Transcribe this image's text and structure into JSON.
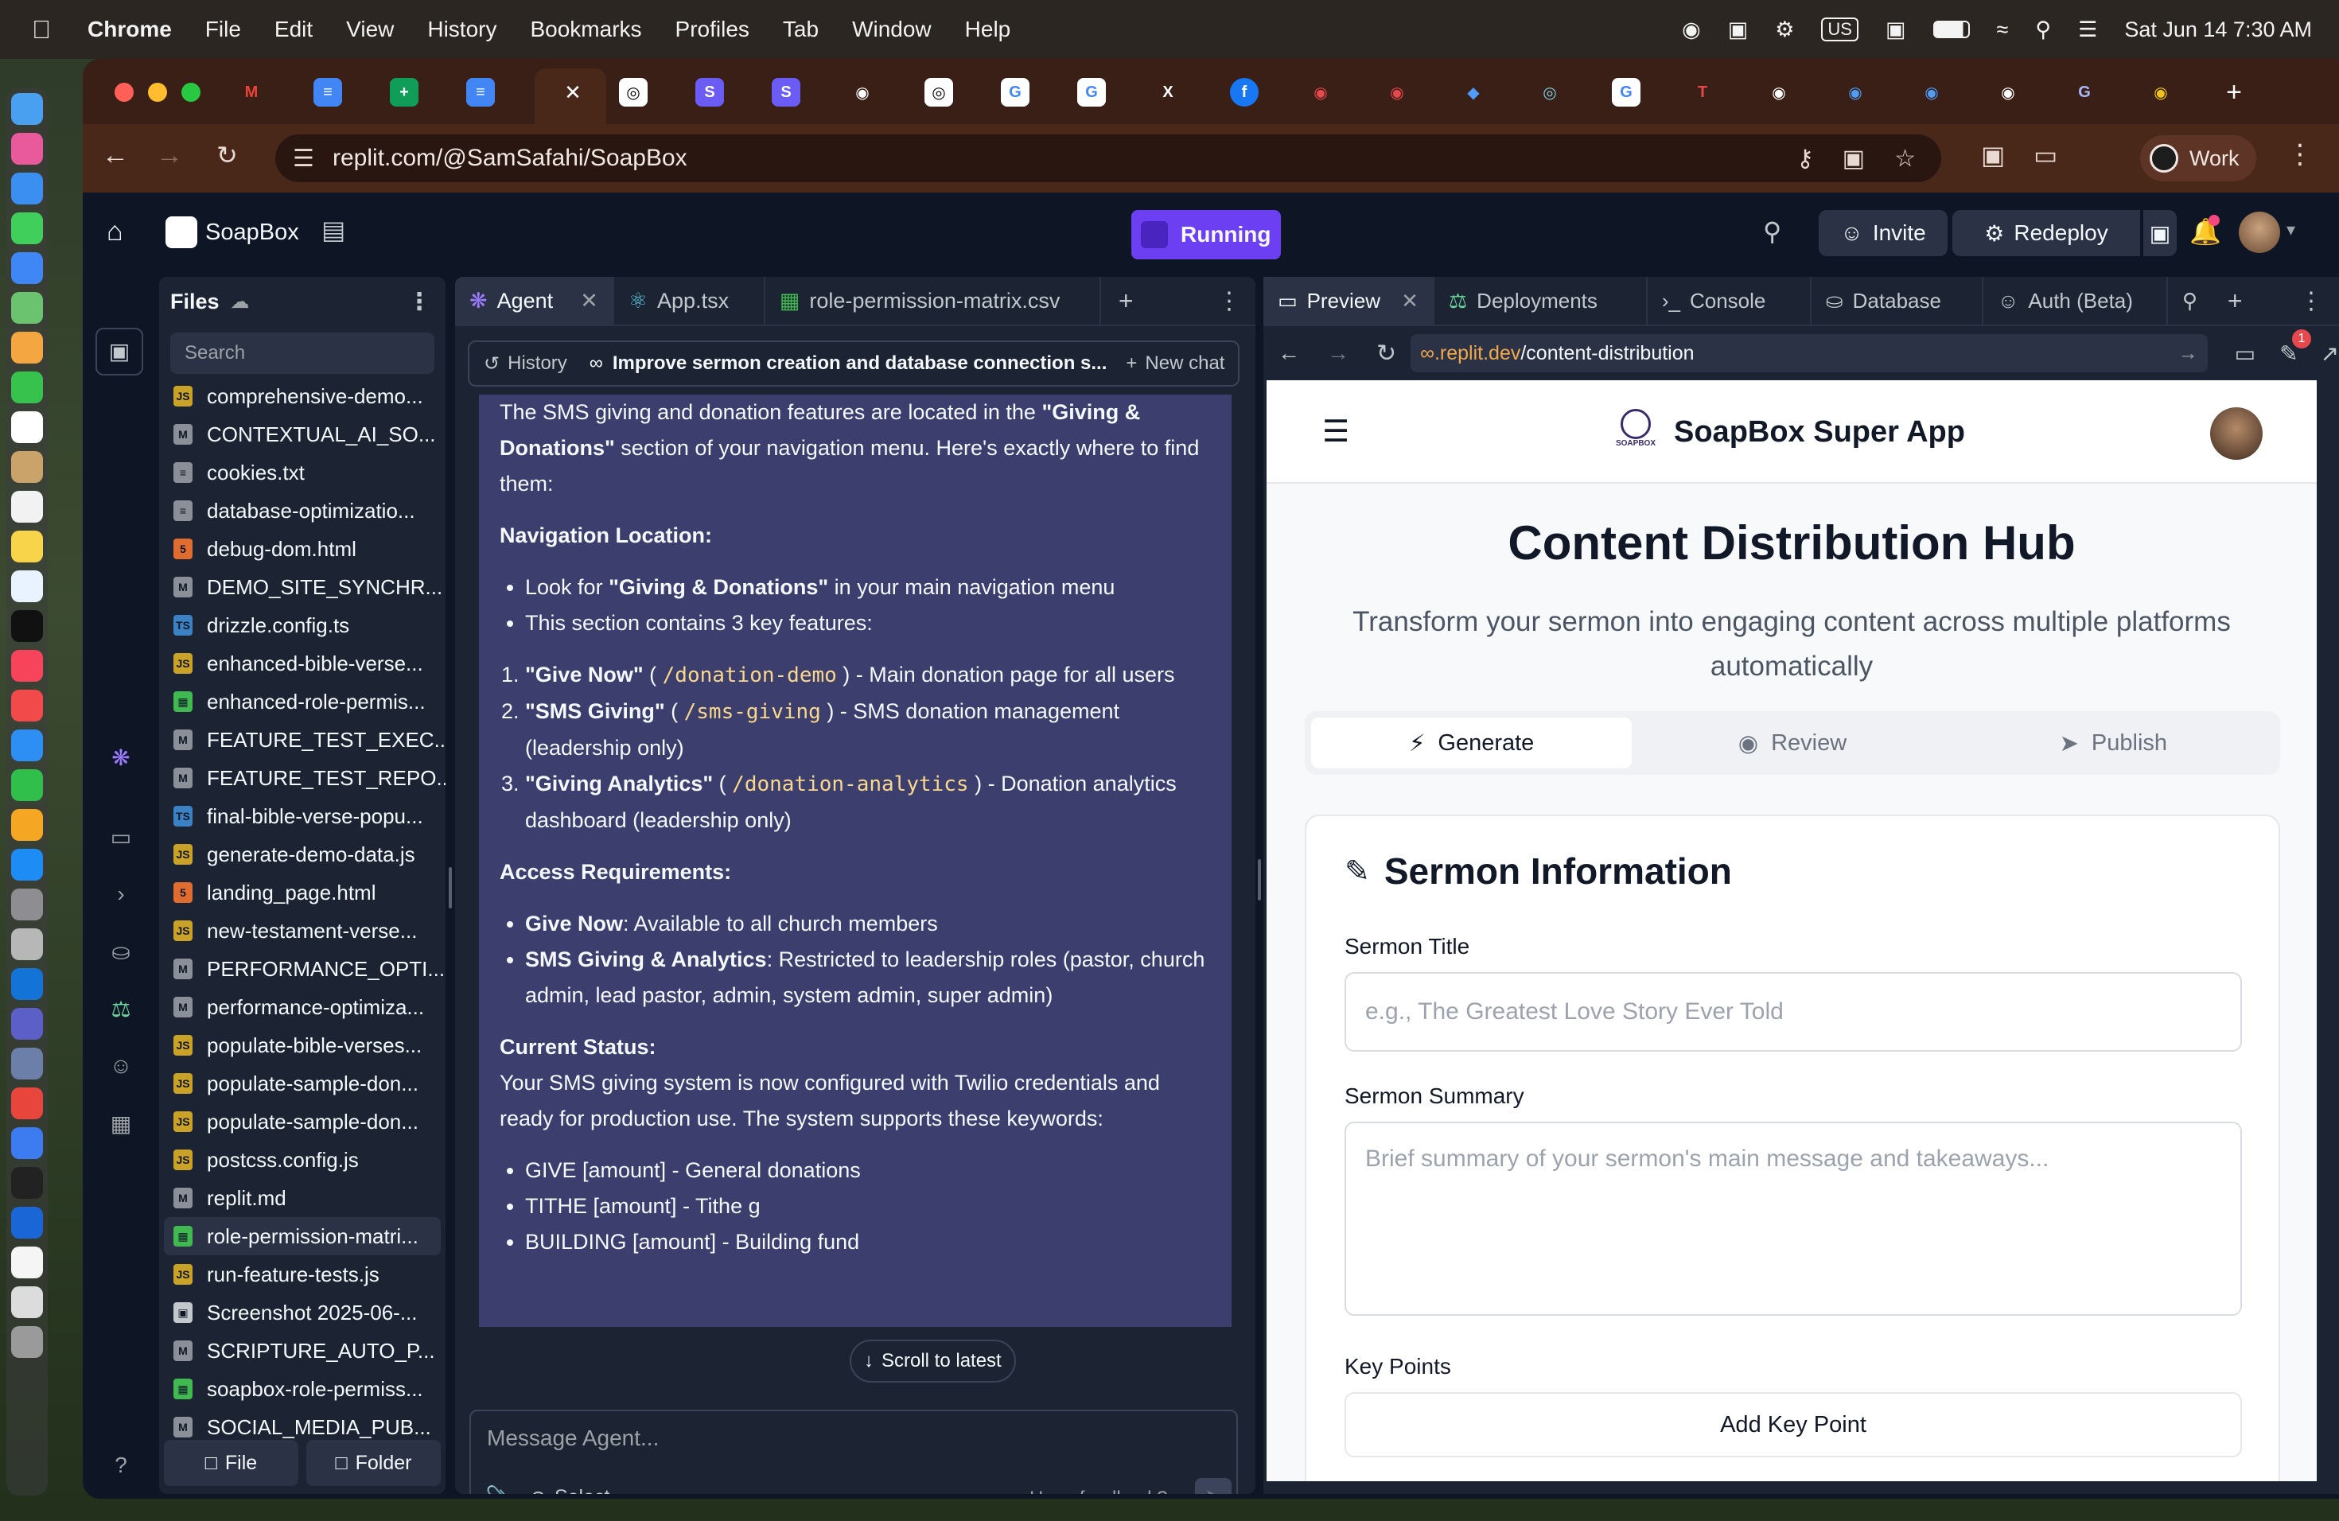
{
  "menubar": {
    "app": "Chrome",
    "items": [
      "File",
      "Edit",
      "View",
      "History",
      "Bookmarks",
      "Profiles",
      "Tab",
      "Window",
      "Help"
    ],
    "keyboard": "US",
    "datetime": "Sat Jun 14  7:30 AM"
  },
  "browser": {
    "url": "replit.com/@SamSafahi/SoapBox",
    "profile": "Work"
  },
  "replit": {
    "project": "SoapBox",
    "running": "Running",
    "invite": "Invite",
    "redeploy": "Redeploy"
  },
  "files": {
    "title": "Files",
    "search": "Search",
    "items": [
      {
        "name": "comprehensive-demo...",
        "type": "js"
      },
      {
        "name": "CONTEXTUAL_AI_SO...",
        "type": "md"
      },
      {
        "name": "cookies.txt",
        "type": "txt"
      },
      {
        "name": "database-optimizatio...",
        "type": "db"
      },
      {
        "name": "debug-dom.html",
        "type": "html"
      },
      {
        "name": "DEMO_SITE_SYNCHR...",
        "type": "md"
      },
      {
        "name": "drizzle.config.ts",
        "type": "ts"
      },
      {
        "name": "enhanced-bible-verse...",
        "type": "js"
      },
      {
        "name": "enhanced-role-permis...",
        "type": "csv"
      },
      {
        "name": "FEATURE_TEST_EXEC...",
        "type": "md"
      },
      {
        "name": "FEATURE_TEST_REPO...",
        "type": "md"
      },
      {
        "name": "final-bible-verse-popu...",
        "type": "ts"
      },
      {
        "name": "generate-demo-data.js",
        "type": "js"
      },
      {
        "name": "landing_page.html",
        "type": "html"
      },
      {
        "name": "new-testament-verse...",
        "type": "js"
      },
      {
        "name": "PERFORMANCE_OPTI...",
        "type": "md"
      },
      {
        "name": "performance-optimiza...",
        "type": "md"
      },
      {
        "name": "populate-bible-verses...",
        "type": "js"
      },
      {
        "name": "populate-sample-don...",
        "type": "js"
      },
      {
        "name": "populate-sample-don...",
        "type": "js"
      },
      {
        "name": "postcss.config.js",
        "type": "js"
      },
      {
        "name": "replit.md",
        "type": "md"
      },
      {
        "name": "role-permission-matri...",
        "type": "csv"
      },
      {
        "name": "run-feature-tests.js",
        "type": "js"
      },
      {
        "name": "Screenshot 2025-06-...",
        "type": "img"
      },
      {
        "name": "SCRIPTURE_AUTO_P...",
        "type": "md"
      },
      {
        "name": "soapbox-role-permiss...",
        "type": "csv"
      },
      {
        "name": "SOCIAL_MEDIA_PUB...",
        "type": "md"
      }
    ],
    "new_file": "File",
    "new_folder": "Folder"
  },
  "agent": {
    "tabs": [
      "Agent",
      "App.tsx",
      "role-permission-matrix.csv"
    ],
    "history": "History",
    "chat_title": "Improve sermon creation and database connection s...",
    "new_chat": "New chat",
    "intro_a": "The SMS giving and donation features are located in the ",
    "intro_b": "\"Giving & Donations\"",
    "intro_c": " section of your navigation menu. Here's exactly where to find them:",
    "h_nav": "Navigation Location:",
    "nav1_a": "Look for ",
    "nav1_b": "\"Giving & Donations\"",
    "nav1_c": " in your main navigation menu",
    "nav2": "This section contains 3 key features:",
    "f1_b": "\"Give Now\"",
    "f1_code": "/donation-demo",
    "f1_c": " ) - Main donation page for all users",
    "f2_b": "\"SMS Giving\"",
    "f2_code": "/sms-giving",
    "f2_c": " ) - SMS donation management (leadership only)",
    "f3_b": "\"Giving Analytics\"",
    "f3_code": "/donation-analytics",
    "f3_c": " ) - Donation analytics dashboard (leadership only)",
    "h_access": "Access Requirements:",
    "a1_b": "Give Now",
    "a1_c": ": Available to all church members",
    "a2_b": "SMS Giving & Analytics",
    "a2_c": ": Restricted to leadership roles (pastor, church admin, lead pastor, admin, system admin, super admin)",
    "h_status": "Current Status:",
    "status": "Your SMS giving system is now configured with Twilio credentials and ready for production use. The system supports these keywords:",
    "k1": "GIVE [amount] - General donations",
    "k2": "TITHE [amount] - Tithe g",
    "k3": "BUILDING [amount] - Building fund",
    "scroll_latest": "Scroll to latest",
    "placeholder": "Message Agent...",
    "select": "Select",
    "feedback": "Have feedback?"
  },
  "preview": {
    "tabs": [
      "Preview",
      "Deployments",
      "Console",
      "Database",
      "Auth (Beta)"
    ],
    "url_host": ".replit.dev",
    "url_path": "/content-distribution",
    "badge": "1",
    "app_name": "SoapBox Super App",
    "logo_text": "SOAPBOX",
    "title": "Content Distribution Hub",
    "subtitle": "Transform your sermon into engaging content across multiple platforms automatically",
    "steps": [
      "Generate",
      "Review",
      "Publish"
    ],
    "card_title": "Sermon Information",
    "sermon_title_label": "Sermon Title",
    "sermon_title_ph": "e.g., The Greatest Love Story Ever Told",
    "summary_label": "Sermon Summary",
    "summary_ph": "Brief summary of your sermon's main message and takeaways...",
    "key_points_label": "Key Points",
    "add_key_point": "Add Key Point"
  },
  "colors": {
    "accent": "#7c5cff",
    "agent_bg": "#3c3f6e",
    "code": "#f9d78c",
    "ide_bg": "#0e1525"
  }
}
